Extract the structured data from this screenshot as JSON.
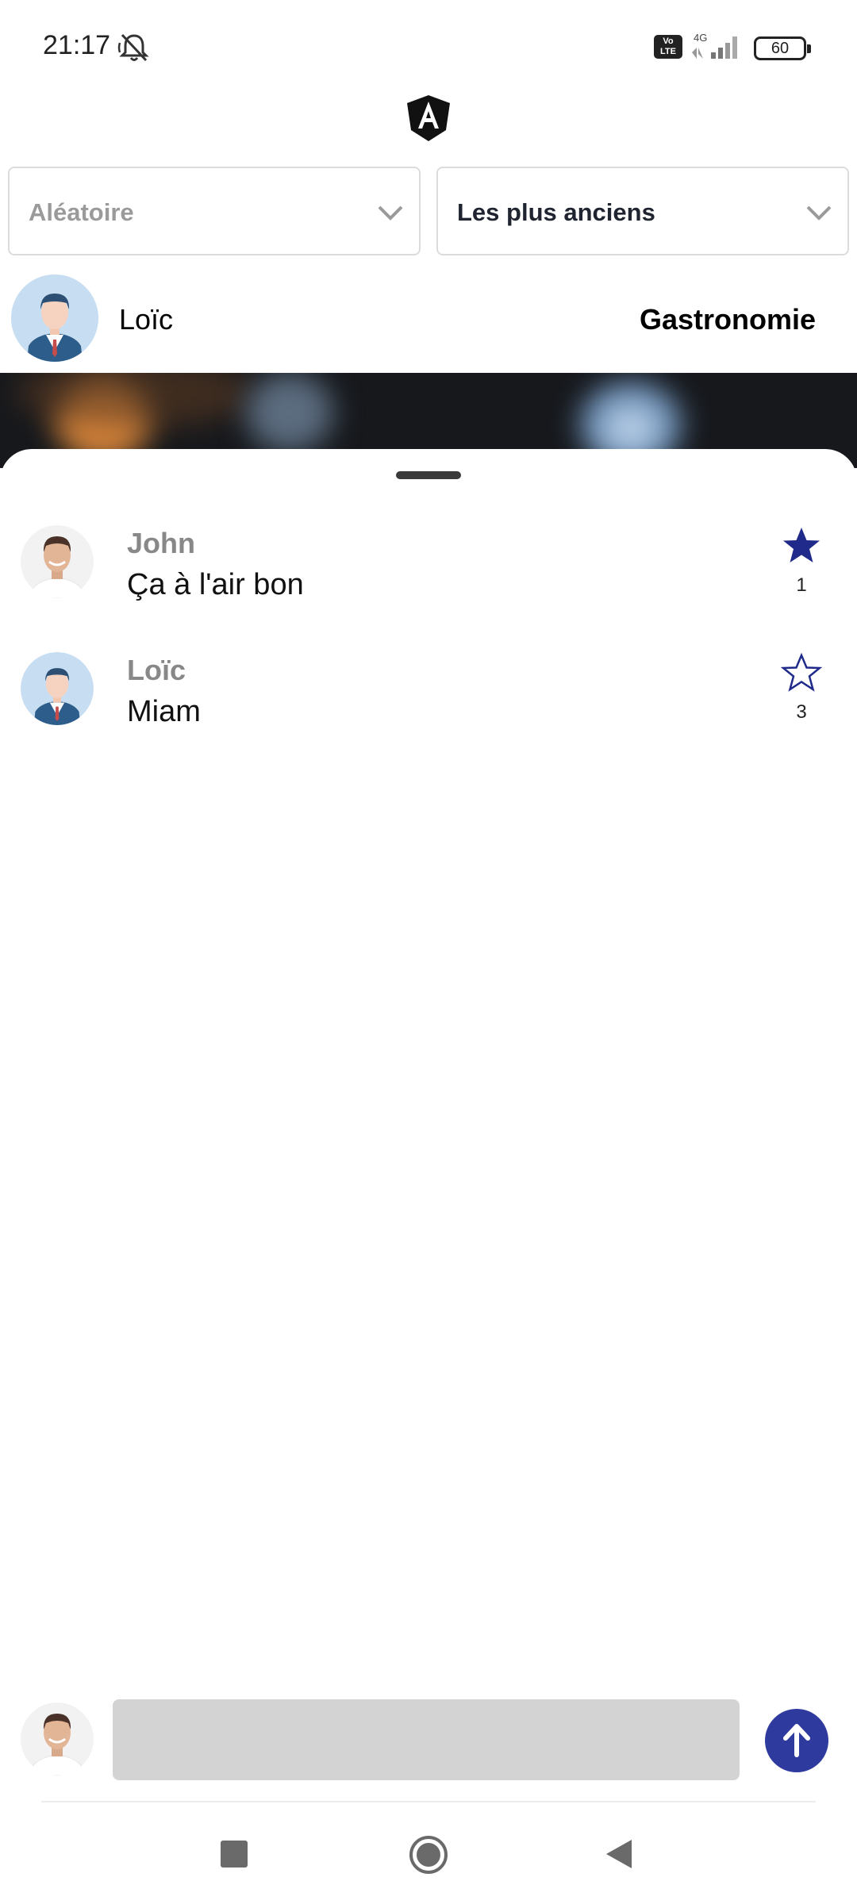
{
  "status_bar": {
    "time": "21:17",
    "volte_label": "Vo\nLTE",
    "network": "4G",
    "battery": "60",
    "icons": [
      "silent-bell-icon",
      "volte-icon",
      "signal-icon",
      "battery-icon"
    ]
  },
  "header": {
    "logo_icon": "angular-logo-icon"
  },
  "filters": {
    "left": {
      "value": "Aléatoire"
    },
    "right": {
      "value": "Les plus anciens"
    }
  },
  "post": {
    "author": "Loïc",
    "category": "Gastronomie"
  },
  "comments": [
    {
      "author": "John",
      "text": "Ça à l'air bon",
      "stars": "1",
      "starred": true,
      "avatar": "john-avatar"
    },
    {
      "author": "Loïc",
      "text": "Miam",
      "stars": "3",
      "starred": false,
      "avatar": "loic-avatar"
    }
  ],
  "composer": {
    "placeholder": ""
  },
  "colors": {
    "accent": "#2f3a9e",
    "star": "#1f2a8a",
    "muted_text": "#888888"
  }
}
